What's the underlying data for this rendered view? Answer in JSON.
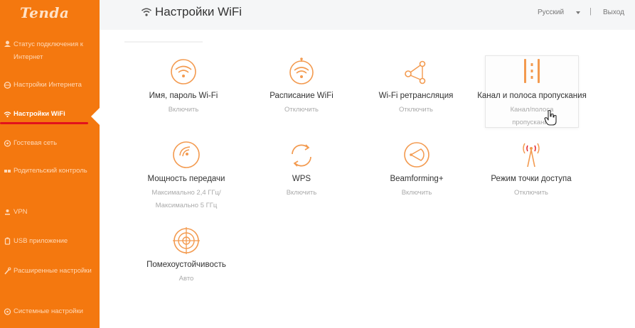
{
  "brand": {
    "logo": "Tenda"
  },
  "sidebar": {
    "items": [
      {
        "label": "Статус подключения к Интернет"
      },
      {
        "label": "Настройки Интернета"
      },
      {
        "label": "Настройки WiFi"
      },
      {
        "label": "Гостевая сеть"
      },
      {
        "label": "Родительский контроль"
      },
      {
        "label": "VPN"
      },
      {
        "label": "USB приложение"
      },
      {
        "label": "Расширенные настройки"
      },
      {
        "label": "Системные настройки"
      }
    ]
  },
  "header": {
    "title": "Настройки WiFi",
    "language": "Русский",
    "divider": "|",
    "logout": "Выход"
  },
  "tiles": [
    {
      "title": "Имя, пароль Wi-Fi",
      "status": "Включить",
      "icon": "wifi-icon"
    },
    {
      "title": "Расписание WiFi",
      "status": "Отключить",
      "icon": "wifi-schedule-icon"
    },
    {
      "title": "Wi-Fi ретрансляция",
      "status": "Отключить",
      "icon": "repeater-icon"
    },
    {
      "title": "Канал и полоса пропускания",
      "status": "Канал/полоса пропускания",
      "icon": "channel-bandwidth-icon"
    },
    {
      "title": "Мощность передачи",
      "status": "Максимально 2,4 ГГц/ Максимально 5 ГГц",
      "icon": "transmit-power-icon"
    },
    {
      "title": "WPS",
      "status": "Включить",
      "icon": "wps-icon"
    },
    {
      "title": "Beamforming+",
      "status": "Включить",
      "icon": "beamforming-icon"
    },
    {
      "title": "Режим точки доступа",
      "status": "Отключить",
      "icon": "access-point-icon"
    },
    {
      "title": "Помехоустойчивость",
      "status": "Авто",
      "icon": "anti-interference-icon"
    }
  ],
  "colors": {
    "sidebar": "#f4780f",
    "accent": "#f39a4f",
    "active_underline": "#e2131c"
  }
}
